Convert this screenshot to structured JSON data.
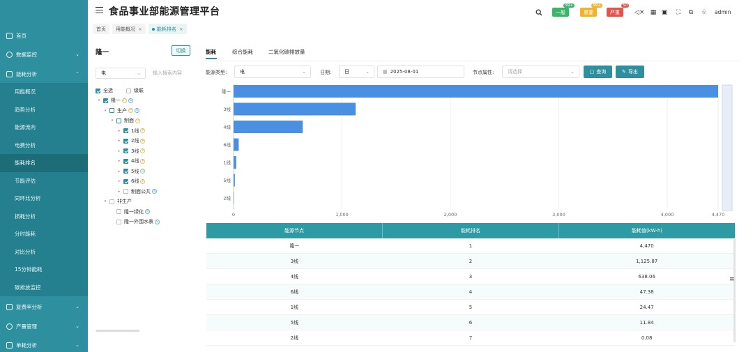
{
  "app": {
    "title": "食品事业部能源管理平台"
  },
  "sidebar": {
    "items": [
      {
        "label": "首页",
        "has_children": false
      },
      {
        "label": "数据监控",
        "has_children": true
      },
      {
        "label": "能耗分析",
        "has_children": true,
        "expanded": true
      },
      {
        "label": "复费率分析",
        "has_children": true
      },
      {
        "label": "产量管理",
        "has_children": true
      },
      {
        "label": "单耗分析",
        "has_children": true
      }
    ],
    "sub_items": [
      {
        "label": "用能概况",
        "active": false
      },
      {
        "label": "趋势分析",
        "active": false
      },
      {
        "label": "能源流向",
        "active": false
      },
      {
        "label": "电费分析",
        "active": false
      },
      {
        "label": "能耗排名",
        "active": true
      },
      {
        "label": "节能评估",
        "active": false
      },
      {
        "label": "同环比分析",
        "active": false
      },
      {
        "label": "损耗分析",
        "active": false
      },
      {
        "label": "分时能耗",
        "active": false
      },
      {
        "label": "对比分析",
        "active": false
      },
      {
        "label": "15分钟能耗",
        "active": false
      },
      {
        "label": "碳排放监控",
        "active": false
      }
    ]
  },
  "tabs": [
    {
      "label": "首页",
      "closable": false,
      "active": false
    },
    {
      "label": "用能概况",
      "closable": true,
      "active": false
    },
    {
      "label": "能耗排名",
      "closable": true,
      "active": true
    }
  ],
  "header": {
    "badges": [
      {
        "label": "一般",
        "count": "99+",
        "color": "#3bb56a"
      },
      {
        "label": "重要",
        "count": "99+",
        "color": "#f0b429"
      },
      {
        "label": "严重",
        "count": "50",
        "color": "#e5534b"
      }
    ],
    "user": "admin",
    "icons": [
      "search-icon",
      "volume-icon",
      "grid-icon",
      "screen-icon",
      "fullscreen-icon",
      "translate-icon",
      "shirt-icon"
    ]
  },
  "left_panel": {
    "title": "隆一",
    "switch_label": "切换",
    "energy_select": "电",
    "search_placeholder": "输入搜索内容",
    "select_all": "全选",
    "cascade": "级联",
    "tree": [
      {
        "label": "隆一",
        "level": 0,
        "checked": "on",
        "tags": [
          "P",
          "S"
        ]
      },
      {
        "label": "生产",
        "level": 1,
        "checked": "half",
        "tags": [
          "P",
          "S"
        ]
      },
      {
        "label": "制面",
        "level": 2,
        "checked": "half",
        "tags": [
          "P"
        ]
      },
      {
        "label": "1线",
        "level": 3,
        "checked": "on",
        "tags": [
          "P"
        ]
      },
      {
        "label": "2线",
        "level": 3,
        "checked": "on",
        "tags": [
          "P"
        ]
      },
      {
        "label": "3线",
        "level": 3,
        "checked": "on",
        "tags": [
          "P"
        ]
      },
      {
        "label": "4线",
        "level": 3,
        "checked": "on",
        "tags": [
          "P"
        ]
      },
      {
        "label": "5线",
        "level": 3,
        "checked": "on",
        "tags": [
          "D"
        ]
      },
      {
        "label": "6线",
        "level": 3,
        "checked": "on",
        "tags": [
          "P"
        ]
      },
      {
        "label": "制面公共",
        "level": 3,
        "checked": "off",
        "tags": [
          "S"
        ]
      },
      {
        "label": "非生产",
        "level": 1,
        "checked": "off",
        "tags": []
      },
      {
        "label": "隆一绿化",
        "level": 2,
        "checked": "off",
        "tags": [
          "S"
        ]
      },
      {
        "label": "隆一外围水表",
        "level": 2,
        "checked": "off",
        "tags": [
          "S"
        ]
      }
    ]
  },
  "main": {
    "tabs": [
      {
        "label": "能耗",
        "active": true
      },
      {
        "label": "综合能耗",
        "active": false
      },
      {
        "label": "二氧化碳排放量",
        "active": false
      }
    ],
    "filters": {
      "energy_type_label": "能源类型:",
      "energy_type_value": "电",
      "date_label": "日期:",
      "date_unit": "日",
      "date_value": "2025-08-01",
      "node_attr_label": "节点属性:",
      "node_attr_placeholder": "请选择",
      "query_label": "查询",
      "export_label": "导出"
    },
    "table": {
      "headers": [
        "能源节点",
        "能耗排名",
        "能耗值(kW·h)"
      ],
      "rows": [
        [
          "隆一",
          "1",
          "4,470"
        ],
        [
          "3线",
          "2",
          "1,125.87"
        ],
        [
          "4线",
          "3",
          "638.06"
        ],
        [
          "6线",
          "4",
          "47.38"
        ],
        [
          "1线",
          "5",
          "24.47"
        ],
        [
          "5线",
          "6",
          "11.84"
        ],
        [
          "2线",
          "7",
          "0.08"
        ]
      ]
    }
  },
  "chart_data": {
    "type": "bar",
    "orientation": "horizontal",
    "categories": [
      "隆一",
      "3线",
      "4线",
      "6线",
      "1线",
      "5线",
      "2线"
    ],
    "values": [
      4470,
      1125.87,
      638.06,
      47.38,
      24.47,
      11.84,
      0.08
    ],
    "x_ticks": [
      "0",
      "1,000",
      "2,000",
      "3,000",
      "4,000",
      "4,470"
    ],
    "xlim": [
      0,
      4470
    ],
    "bar_color": "#4a90e2",
    "grid": true
  }
}
